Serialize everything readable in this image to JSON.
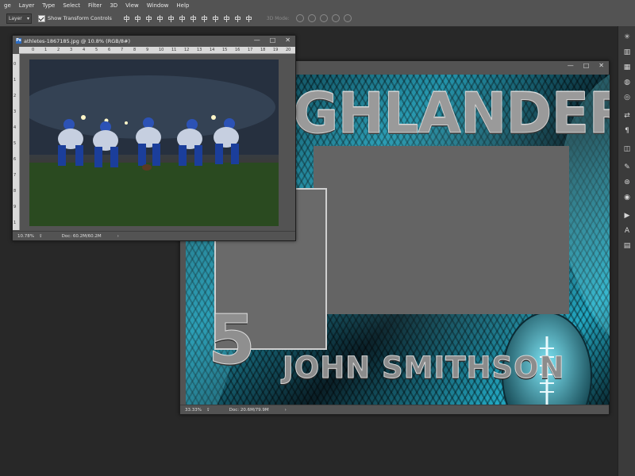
{
  "menubar": {
    "items": [
      "ge",
      "Layer",
      "Type",
      "Select",
      "Filter",
      "3D",
      "View",
      "Window",
      "Help"
    ]
  },
  "options": {
    "auto_select_value": "Layer",
    "show_transform_label": "Show Transform Controls",
    "mode_3d_label": "3D Mode:"
  },
  "doc_card": {
    "zoom": "33.33%",
    "doc_size": "Doc: 20.6M/79.9M",
    "headline": "GHLANDERS",
    "number": "5",
    "player_name": "JOHN SMITHSON"
  },
  "doc_photo": {
    "title": "athletes-1867185.jpg @ 10.8% (RGB/8#)",
    "zoom": "10.78%",
    "doc_size": "Doc: 60.2M/60.2M",
    "ruler_h": [
      "0",
      "1",
      "2",
      "3",
      "4",
      "5",
      "6",
      "7",
      "8",
      "9",
      "10",
      "11",
      "12",
      "13",
      "14",
      "15",
      "16",
      "17",
      "18",
      "19",
      "20"
    ],
    "ruler_v": [
      "0",
      "1",
      "2",
      "3",
      "4",
      "5",
      "6",
      "7",
      "8",
      "9",
      "1"
    ]
  },
  "window_buttons": {
    "minimize": "—",
    "maximize": "□",
    "close": "✕"
  },
  "colors": {
    "accent": "#2fb6cf",
    "ui_bg": "#535353",
    "workspace": "#282828"
  },
  "right_panel_icons": [
    "histogram-icon",
    "layers-icon",
    "swatches-icon",
    "adjustments-icon",
    "styles-icon",
    "history-icon",
    "paragraph-icon",
    "3d-icon",
    "brushes-icon",
    "clone-source-icon",
    "channels-icon",
    "paths-icon",
    "actions-icon",
    "character-icon",
    "grid-icon"
  ]
}
